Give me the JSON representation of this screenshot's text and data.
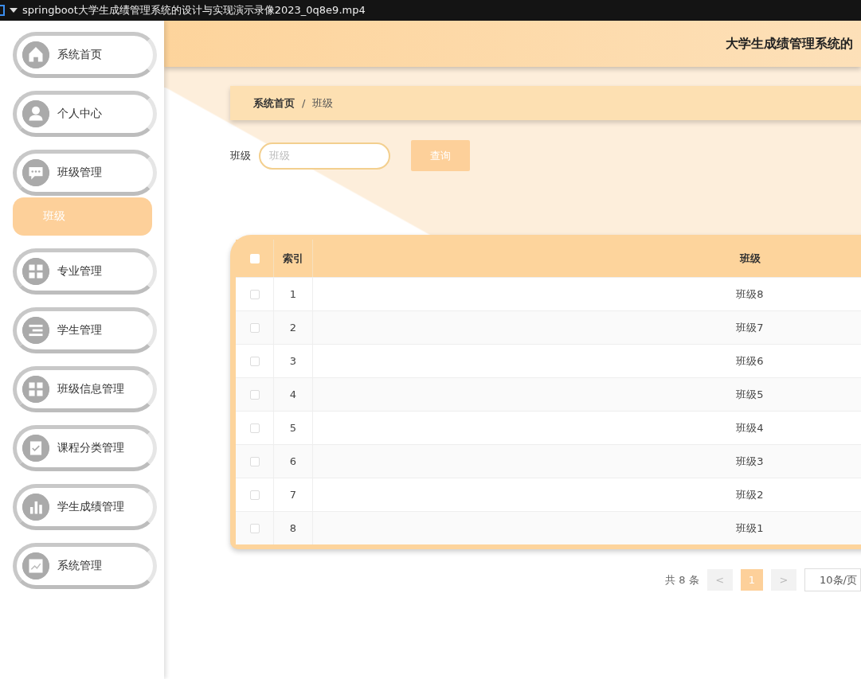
{
  "window": {
    "title": "springboot大学生成绩管理系统的设计与实现演示录像2023_0q8e9.mp4"
  },
  "sidebar": {
    "items": [
      {
        "label": "系统首页",
        "selected": false
      },
      {
        "label": "个人中心",
        "selected": false
      },
      {
        "label": "班级管理",
        "selected": false,
        "children": [
          {
            "label": "班级",
            "selected": true
          }
        ]
      },
      {
        "label": "专业管理",
        "selected": false
      },
      {
        "label": "学生管理",
        "selected": false
      },
      {
        "label": "班级信息管理",
        "selected": false
      },
      {
        "label": "课程分类管理",
        "selected": false
      },
      {
        "label": "学生成绩管理",
        "selected": false
      },
      {
        "label": "系统管理",
        "selected": false
      }
    ]
  },
  "header": {
    "title": "大学生成绩管理系统的"
  },
  "breadcrumb": [
    "系统首页",
    "/",
    "班级"
  ],
  "search": {
    "label": "班级",
    "placeholder": "班级",
    "button": "查询"
  },
  "table": {
    "header_checked": false,
    "columns": [
      "索引",
      "班级"
    ],
    "rows": [
      {
        "checked": false,
        "cells": [
          "1",
          "班级8"
        ]
      },
      {
        "checked": false,
        "cells": [
          "2",
          "班级7"
        ]
      },
      {
        "checked": false,
        "cells": [
          "3",
          "班级6"
        ]
      },
      {
        "checked": false,
        "cells": [
          "4",
          "班级5"
        ]
      },
      {
        "checked": false,
        "cells": [
          "5",
          "班级4"
        ]
      },
      {
        "checked": false,
        "cells": [
          "6",
          "班级3"
        ]
      },
      {
        "checked": false,
        "cells": [
          "7",
          "班级2"
        ]
      },
      {
        "checked": false,
        "cells": [
          "8",
          "班级1"
        ]
      }
    ]
  },
  "pagination": {
    "total": "共 8 条",
    "prev": "<",
    "pages": [
      {
        "label": "1",
        "selected": true
      }
    ],
    "next": ">",
    "page_size": "10条/页"
  }
}
